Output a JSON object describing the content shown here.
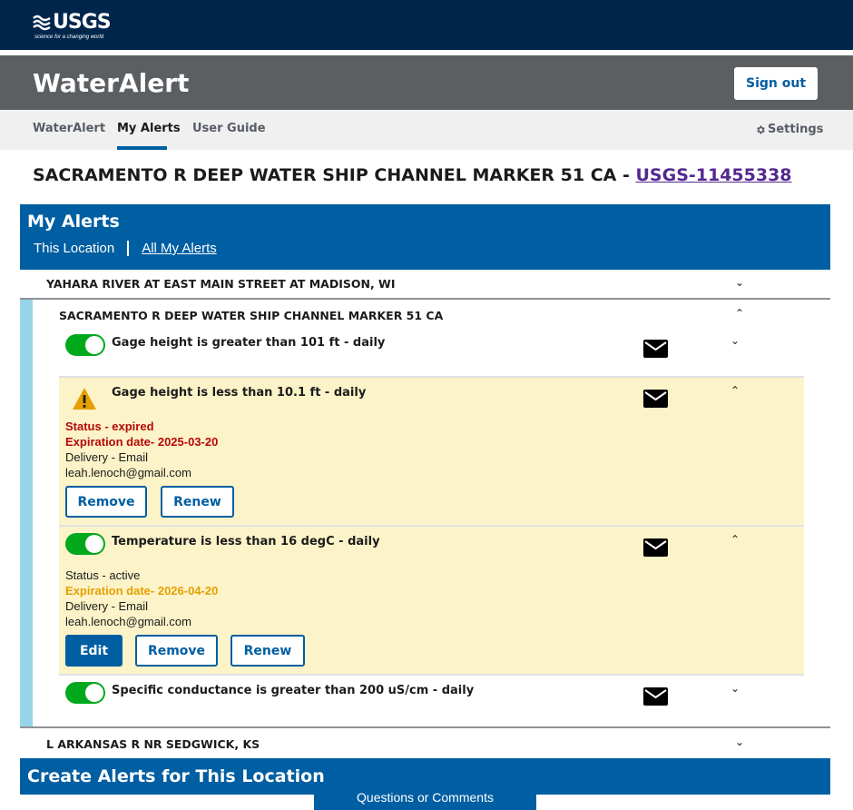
{
  "brand": {
    "logo_text": "USGS",
    "tagline": "science for a changing world"
  },
  "app": {
    "title": "WaterAlert",
    "sign_out_label": "Sign out"
  },
  "nav": {
    "items": [
      {
        "label": "WaterAlert"
      },
      {
        "label": "My Alerts",
        "active": true
      },
      {
        "label": "User Guide"
      }
    ],
    "settings_label": "Settings"
  },
  "page": {
    "heading_prefix": "SACRAMENTO R DEEP WATER SHIP CHANNEL MARKER 51 CA - ",
    "site_link": "USGS-11455338"
  },
  "my_alerts": {
    "title": "My Alerts",
    "tab_this_location": "This Location",
    "tab_all": "All My Alerts"
  },
  "sites": [
    {
      "name": "YAHARA RIVER AT EAST MAIN STREET AT MADISON, WI",
      "expanded": false
    },
    {
      "name": "SACRAMENTO R DEEP WATER SHIP CHANNEL MARKER 51 CA",
      "expanded": true
    },
    {
      "name": "L ARKANSAS R NR SEDGWICK, KS",
      "expanded": false
    }
  ],
  "alerts": [
    {
      "title": "Gage height is greater than 101 ft - daily",
      "enabled": true,
      "expanded": false
    },
    {
      "title": "Gage height is less than 10.1 ft - daily",
      "warning": true,
      "expanded": true,
      "status": "Status - expired",
      "expiration": "Expiration date- 2025-03-20",
      "delivery": "Delivery - Email",
      "email": "leah.lenoch@gmail.com",
      "buttons": {
        "remove": "Remove",
        "renew": "Renew"
      }
    },
    {
      "title": "Temperature is less than 16 degC - daily",
      "enabled": true,
      "expanded": true,
      "status": "Status - active",
      "expiration": "Expiration date- 2026-04-20",
      "delivery": "Delivery - Email",
      "email": "leah.lenoch@gmail.com",
      "buttons": {
        "edit": "Edit",
        "remove": "Remove",
        "renew": "Renew"
      }
    },
    {
      "title": "Specific conductance is greater than 200 uS/cm - daily",
      "enabled": true,
      "expanded": false
    }
  ],
  "create_alerts": {
    "title": "Create Alerts for This Location"
  },
  "feedback": {
    "label": "Questions or Comments"
  },
  "colors": {
    "usgs_navy": "#00264c",
    "app_bar_gray": "#5c5f62",
    "primary_blue": "#005ea2",
    "expired_red": "#b50909",
    "expiring_amber": "#e5a000",
    "toggle_green": "#00a91c",
    "highlight_yellow": "#fcf3c8",
    "accent_light_blue": "#97d4ea"
  },
  "icons": {
    "mail": "envelope-icon",
    "warning": "warning-triangle-icon",
    "settings": "gear-icon",
    "chevron_down": "chevron-down-icon",
    "chevron_up": "chevron-up-icon"
  }
}
